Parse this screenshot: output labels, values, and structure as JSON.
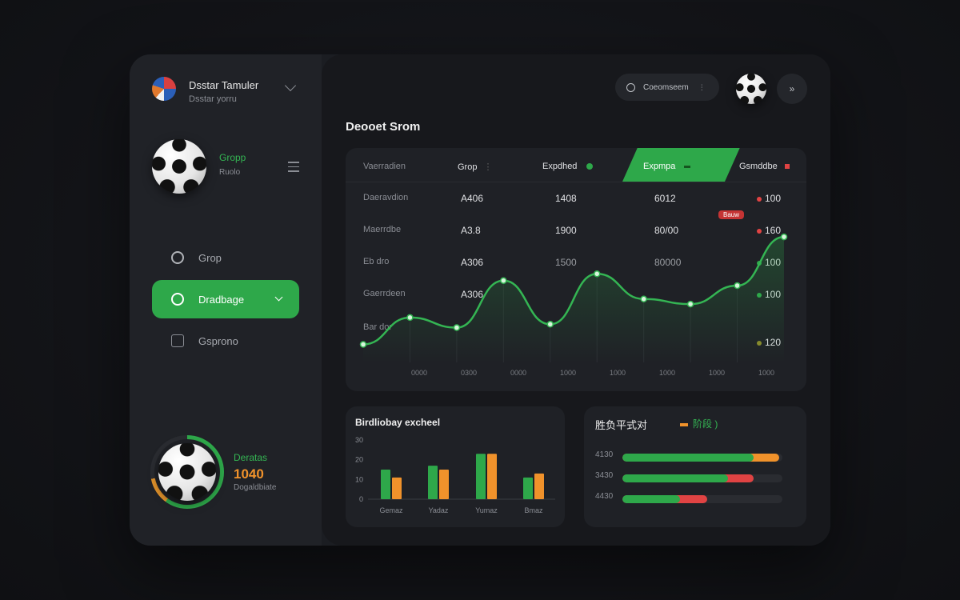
{
  "sidebar": {
    "brand_title": "Dsstar Tamuler",
    "brand_subtitle": "Dsstar yorru",
    "profile_name": "Gropp",
    "profile_sub": "Ruolo",
    "nav": [
      {
        "label": "Grop",
        "active": false
      },
      {
        "label": "Dradbage",
        "active": true
      },
      {
        "label": "Gsprono",
        "active": false
      }
    ],
    "stat_title": "Deratas",
    "stat_value": "1040",
    "stat_sub": "Dogaldbiate",
    "stat_progress": 0.7
  },
  "header": {
    "search_label": "Coeomseem",
    "more_label": "»"
  },
  "main_title": "Deooet Srom",
  "table": {
    "headers": [
      "Vaerradien",
      "Grop",
      "Expdhed",
      "Expmpa",
      "Gsmddbe"
    ],
    "rows": [
      {
        "label": "Daeravdion",
        "c1": "A406",
        "c2": "1408",
        "c3": "6012",
        "c4": "100"
      },
      {
        "label": "Maerrdbe",
        "c1": "A3.8",
        "c2": "1900",
        "c3": "80/00",
        "c4": "160"
      },
      {
        "label": "Eb dro",
        "c1": "A306",
        "c2": "1500",
        "c3": "80000",
        "c4": "100"
      },
      {
        "label": "Gaerrdeen",
        "c1": "A306",
        "c2": "",
        "c3": "",
        "c4": "100"
      },
      {
        "label": "Bar dor",
        "c1": "",
        "c2": "",
        "c3": "",
        "c4": "120"
      }
    ],
    "badge": "Bauw"
  },
  "chart_data": [
    {
      "type": "line",
      "x": [
        "0000",
        "0300",
        "0000",
        "1000",
        "1000",
        "1000",
        "1000",
        "1000"
      ],
      "points": [
        {
          "x": 0,
          "y": 10
        },
        {
          "x": 1,
          "y": 42
        },
        {
          "x": 2,
          "y": 30
        },
        {
          "x": 3,
          "y": 86
        },
        {
          "x": 4,
          "y": 34
        },
        {
          "x": 5,
          "y": 94
        },
        {
          "x": 6,
          "y": 64
        },
        {
          "x": 7,
          "y": 58
        },
        {
          "x": 8,
          "y": 80
        },
        {
          "x": 9,
          "y": 138
        }
      ],
      "series_color": "#34b553"
    },
    {
      "type": "bar",
      "title": "Birdliobay excheel",
      "categories": [
        "Gemaz",
        "Yadaz",
        "Yumaz",
        "Bmaz"
      ],
      "ylim": [
        0,
        30
      ],
      "yticks": [
        "30",
        "20",
        "10",
        "0"
      ],
      "series": [
        {
          "values": [
            15,
            17,
            23,
            11
          ],
          "color": "#2ea84a"
        },
        {
          "values": [
            11,
            15,
            23,
            13
          ],
          "color": "#f0922b"
        }
      ]
    }
  ],
  "progress_panel": {
    "title": "胜负平式对",
    "legend_label": "阶段 )",
    "rows": [
      {
        "label": "4130",
        "green": 0.82,
        "extra": 0.16,
        "extra_color": "#f0922b"
      },
      {
        "label": "3430",
        "green": 0.66,
        "extra": 0.16,
        "extra_color": "#e04343"
      },
      {
        "label": "4430",
        "green": 0.36,
        "extra": 0.17,
        "extra_color": "#e04343"
      }
    ]
  }
}
